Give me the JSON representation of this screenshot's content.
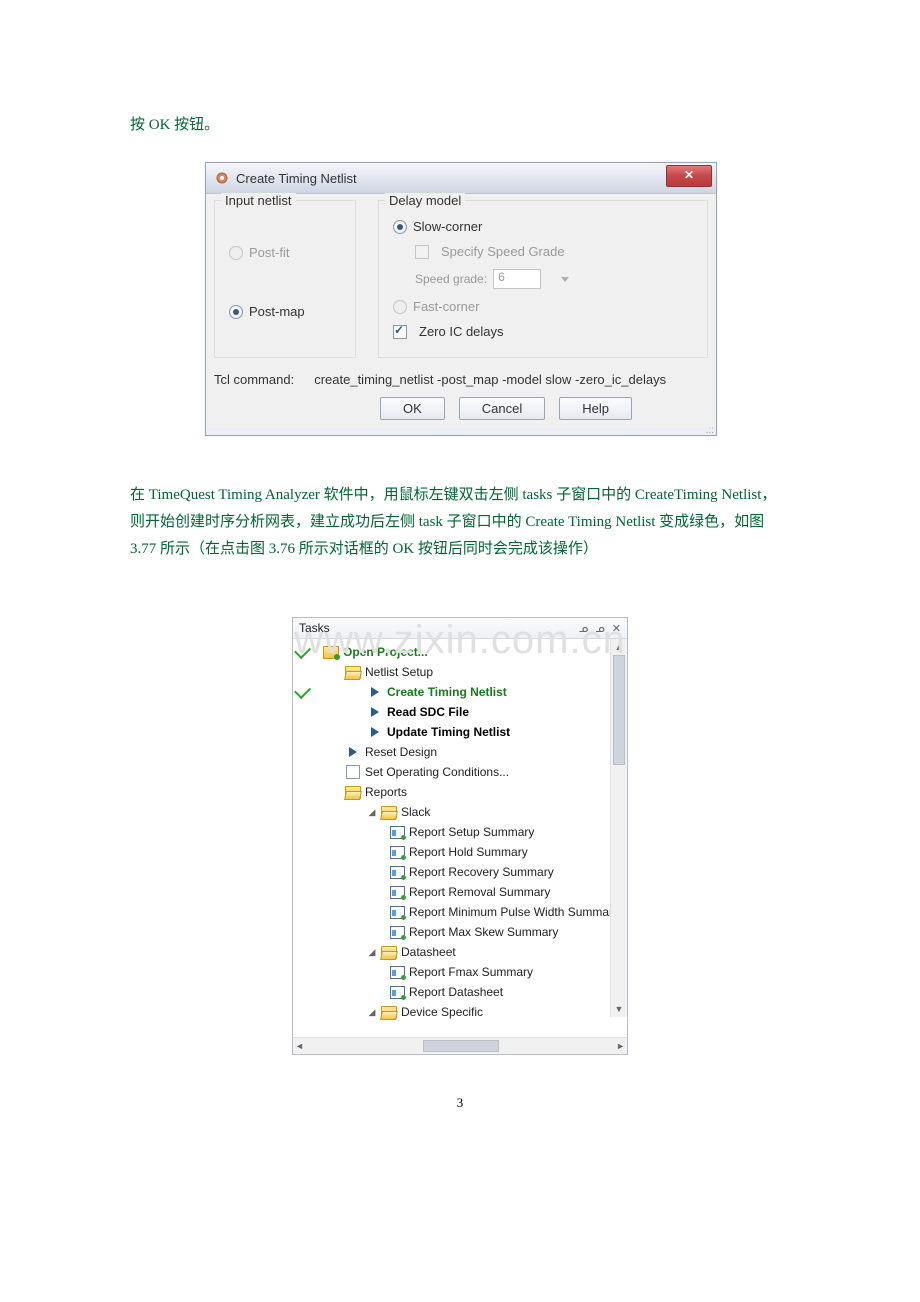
{
  "intro_text": "按 OK 按钮。",
  "dialog": {
    "title": "Create Timing Netlist",
    "close_glyph": "✕",
    "left": {
      "legend": "Input netlist",
      "items": [
        {
          "label": "Post-fit",
          "selected": false
        },
        {
          "label": "Post-map",
          "selected": true
        }
      ]
    },
    "right": {
      "legend": "Delay model",
      "slow_corner": {
        "label": "Slow-corner",
        "selected": true
      },
      "specify_speed": {
        "label": "Specify Speed Grade",
        "checked": false
      },
      "speed_grade_label": "Speed grade:",
      "speed_grade_value": "6",
      "fast_corner": {
        "label": "Fast-corner",
        "selected": false
      },
      "zero_ic": {
        "label": "Zero IC delays",
        "checked": true
      }
    },
    "tcl_label": "Tcl command:",
    "tcl_value": "create_timing_netlist -post_map -model slow -zero_ic_delays",
    "ok": "OK",
    "cancel": "Cancel",
    "help": "Help"
  },
  "paragraph": "在 TimeQuest Timing Analyzer 软件中，用鼠标左键双击左侧 tasks 子窗口中的 CreateTiming Netlist，则开始创建时序分析网表，建立成功后左侧 task 子窗口中的 Create Timing Netlist 变成绿色，如图 3.77 所示（在点击图 3.76 所示对话框的 OK 按钮后同时会完成该操作）",
  "watermark": "www.zixin.com.cn",
  "tasks": {
    "title": "Tasks",
    "header_icons": "ᓄ ᓄ ✕",
    "items": [
      {
        "indent": 0,
        "status": "check",
        "icon": "folder-proj",
        "label": "Open Project...",
        "style": "bold-green"
      },
      {
        "indent": 1,
        "status": "",
        "icon": "folder-open",
        "label": "Netlist Setup",
        "style": "plain"
      },
      {
        "indent": 2,
        "status": "check",
        "icon": "play",
        "label": "Create Timing Netlist",
        "style": "bold-green"
      },
      {
        "indent": 2,
        "status": "",
        "icon": "play",
        "label": "Read SDC File",
        "style": "bold-black"
      },
      {
        "indent": 2,
        "status": "",
        "icon": "play",
        "label": "Update Timing Netlist",
        "style": "bold-black"
      },
      {
        "indent": 1,
        "status": "",
        "icon": "play",
        "label": "Reset Design",
        "style": "plain"
      },
      {
        "indent": 1,
        "status": "",
        "icon": "square",
        "label": "Set Operating Conditions...",
        "style": "plain"
      },
      {
        "indent": 1,
        "status": "",
        "icon": "folder-open",
        "label": "Reports",
        "style": "plain"
      },
      {
        "indent": 2,
        "status": "",
        "icon": "folder-open",
        "expander": "◢",
        "label": "Slack",
        "style": "plain"
      },
      {
        "indent": 3,
        "status": "",
        "icon": "report",
        "label": "Report Setup Summary",
        "style": "plain"
      },
      {
        "indent": 3,
        "status": "",
        "icon": "report",
        "label": "Report Hold Summary",
        "style": "plain"
      },
      {
        "indent": 3,
        "status": "",
        "icon": "report",
        "label": "Report Recovery Summary",
        "style": "plain"
      },
      {
        "indent": 3,
        "status": "",
        "icon": "report",
        "label": "Report Removal Summary",
        "style": "plain"
      },
      {
        "indent": 3,
        "status": "",
        "icon": "report",
        "label": "Report Minimum Pulse Width Summar",
        "style": "plain"
      },
      {
        "indent": 3,
        "status": "",
        "icon": "report",
        "label": "Report Max Skew Summary",
        "style": "plain"
      },
      {
        "indent": 2,
        "status": "",
        "icon": "folder-open",
        "expander": "◢",
        "label": "Datasheet",
        "style": "plain"
      },
      {
        "indent": 3,
        "status": "",
        "icon": "report",
        "label": "Report Fmax Summary",
        "style": "plain"
      },
      {
        "indent": 3,
        "status": "",
        "icon": "report",
        "label": "Report Datasheet",
        "style": "plain"
      },
      {
        "indent": 2,
        "status": "",
        "icon": "folder-open",
        "expander": "◢",
        "label": "Device Specific",
        "style": "plain"
      }
    ]
  },
  "page_number": "3"
}
